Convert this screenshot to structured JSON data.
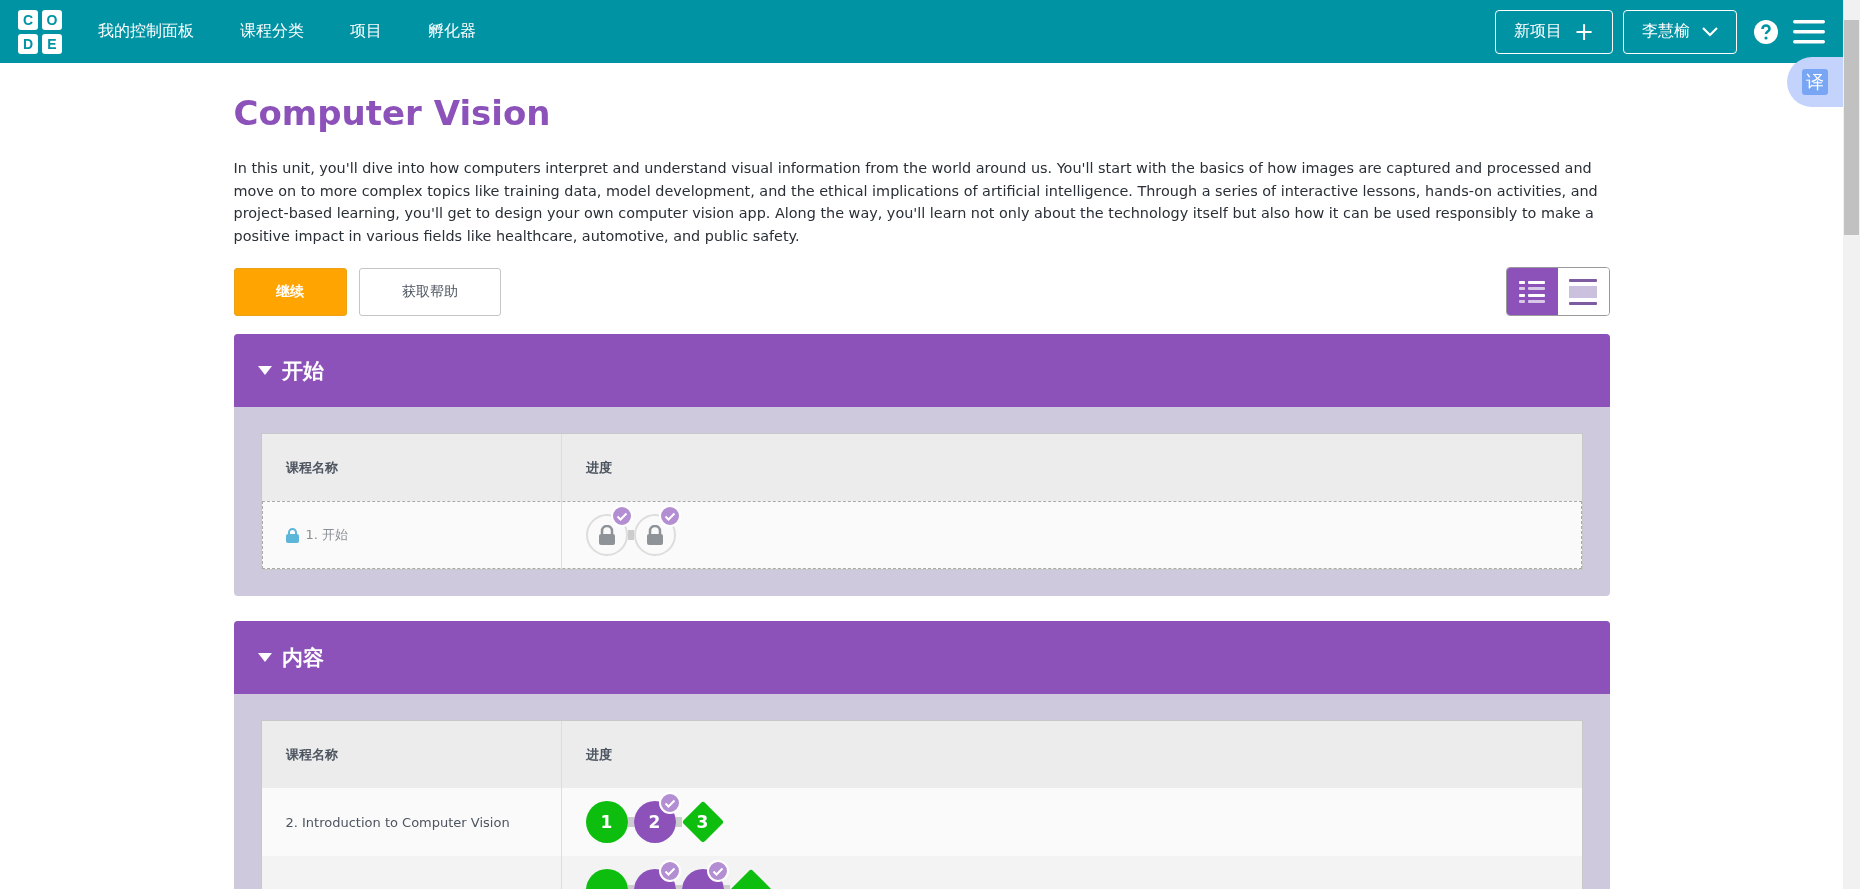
{
  "header": {
    "logo": [
      "C",
      "O",
      "D",
      "E"
    ],
    "nav": [
      "我的控制面板",
      "课程分类",
      "项目",
      "孵化器"
    ],
    "new_project": {
      "label": "新项目",
      "symbol": "+"
    },
    "user": "李慧榆"
  },
  "translate_button": "译",
  "unit": {
    "title": "Computer Vision",
    "description": "In this unit, you'll dive into how computers interpret and understand visual information from the world around us. You'll start with the basics of how images are captured and processed and move on to more complex topics like training data, model development, and the ethical implications of artificial intelligence. Through a series of interactive lessons, hands-on activities, and project-based learning, you'll get to design your own computer vision app. Along the way, you'll learn not only about the technology itself but also how it can be used responsibly to make a positive impact in various fields like healthcare, automotive, and public safety.",
    "actions": [
      "继续",
      "获取帮助"
    ],
    "view_toggle": [
      {
        "kind": "detail",
        "selected": true
      },
      {
        "kind": "summary",
        "selected": false
      }
    ]
  },
  "sections": [
    {
      "title": "开始",
      "expanded": true,
      "columns": [
        "课程名称",
        "进度"
      ],
      "rows": [
        {
          "name": "1. 开始",
          "locked": true,
          "bubbles": [
            {
              "kind": "locked",
              "checked": true
            },
            {
              "kind": "locked",
              "checked": true
            }
          ]
        }
      ]
    },
    {
      "title": "内容",
      "expanded": true,
      "columns": [
        "课程名称",
        "进度"
      ],
      "rows": [
        {
          "name": "2. Introduction to Computer Vision",
          "locked": false,
          "bubbles": [
            {
              "kind": "circle",
              "label": "1",
              "color": "#0ebe0e",
              "checked": false
            },
            {
              "kind": "circle",
              "label": "2",
              "color": "#8c52ba",
              "checked": true
            },
            {
              "kind": "diamond",
              "label": "3",
              "color": "#0ebe0e",
              "checked": false
            }
          ]
        },
        {
          "locked": false,
          "bubbles": [
            {
              "kind": "circle",
              "color": "#0ebe0e",
              "checked": false
            },
            {
              "kind": "circle",
              "color": "#8c52ba",
              "checked": true
            },
            {
              "kind": "circle",
              "color": "#8c52ba",
              "checked": true
            },
            {
              "kind": "diamond",
              "color": "#0ebe0e",
              "checked": false
            }
          ]
        }
      ]
    }
  ]
}
